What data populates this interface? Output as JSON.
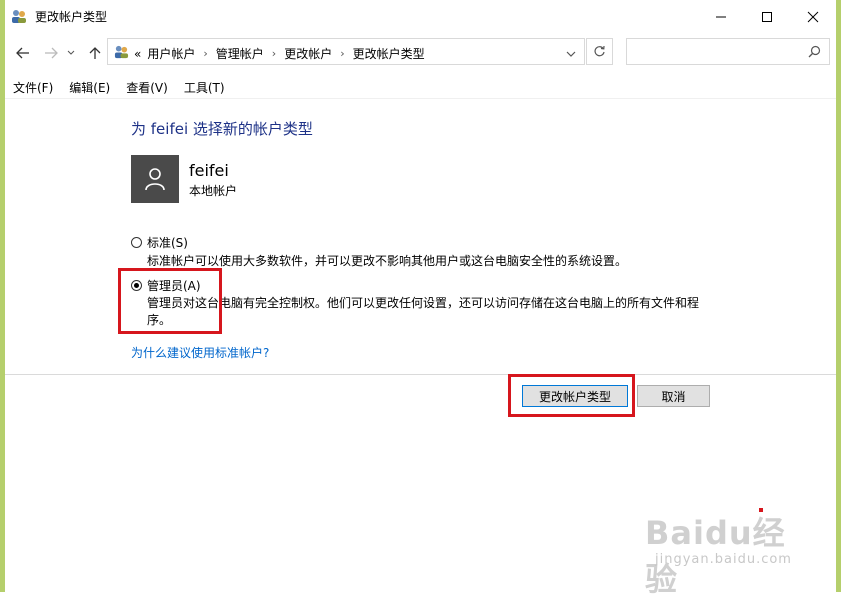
{
  "window": {
    "title": "更改帐户类型"
  },
  "addressbar": {
    "prefix": "«",
    "crumbs": [
      "用户帐户",
      "管理帐户",
      "更改帐户",
      "更改帐户类型"
    ],
    "search_placeholder": ""
  },
  "menu": [
    "文件(F)",
    "编辑(E)",
    "查看(V)",
    "工具(T)"
  ],
  "content": {
    "heading": "为 feifei 选择新的帐户类型",
    "user": {
      "name": "feifei",
      "type": "本地帐户"
    },
    "options": [
      {
        "label": "标准(S)",
        "desc_lines": [
          "标准帐户可以使用大多数软件，并可以更改不影响其他用户或这台电脑安全性的系统设置。"
        ],
        "checked": false
      },
      {
        "label": "管理员(A)",
        "desc_lines": [
          "管理员对这台电脑有完全控制权。他们可以更改任何设置，还可以访问存储在这台电脑上的所有文件和程",
          "序。"
        ],
        "checked": true
      }
    ],
    "help_link": "为什么建议使用标准帐户?"
  },
  "buttons": {
    "change": "更改帐户类型",
    "cancel": "取消"
  },
  "watermark": {
    "big": "Baidu经验",
    "small": "jingyan.baidu.com"
  },
  "colors": {
    "frame": "#b5cf6c",
    "heading": "#1e3287",
    "link": "#0066cc",
    "highlight": "#d6161d"
  }
}
